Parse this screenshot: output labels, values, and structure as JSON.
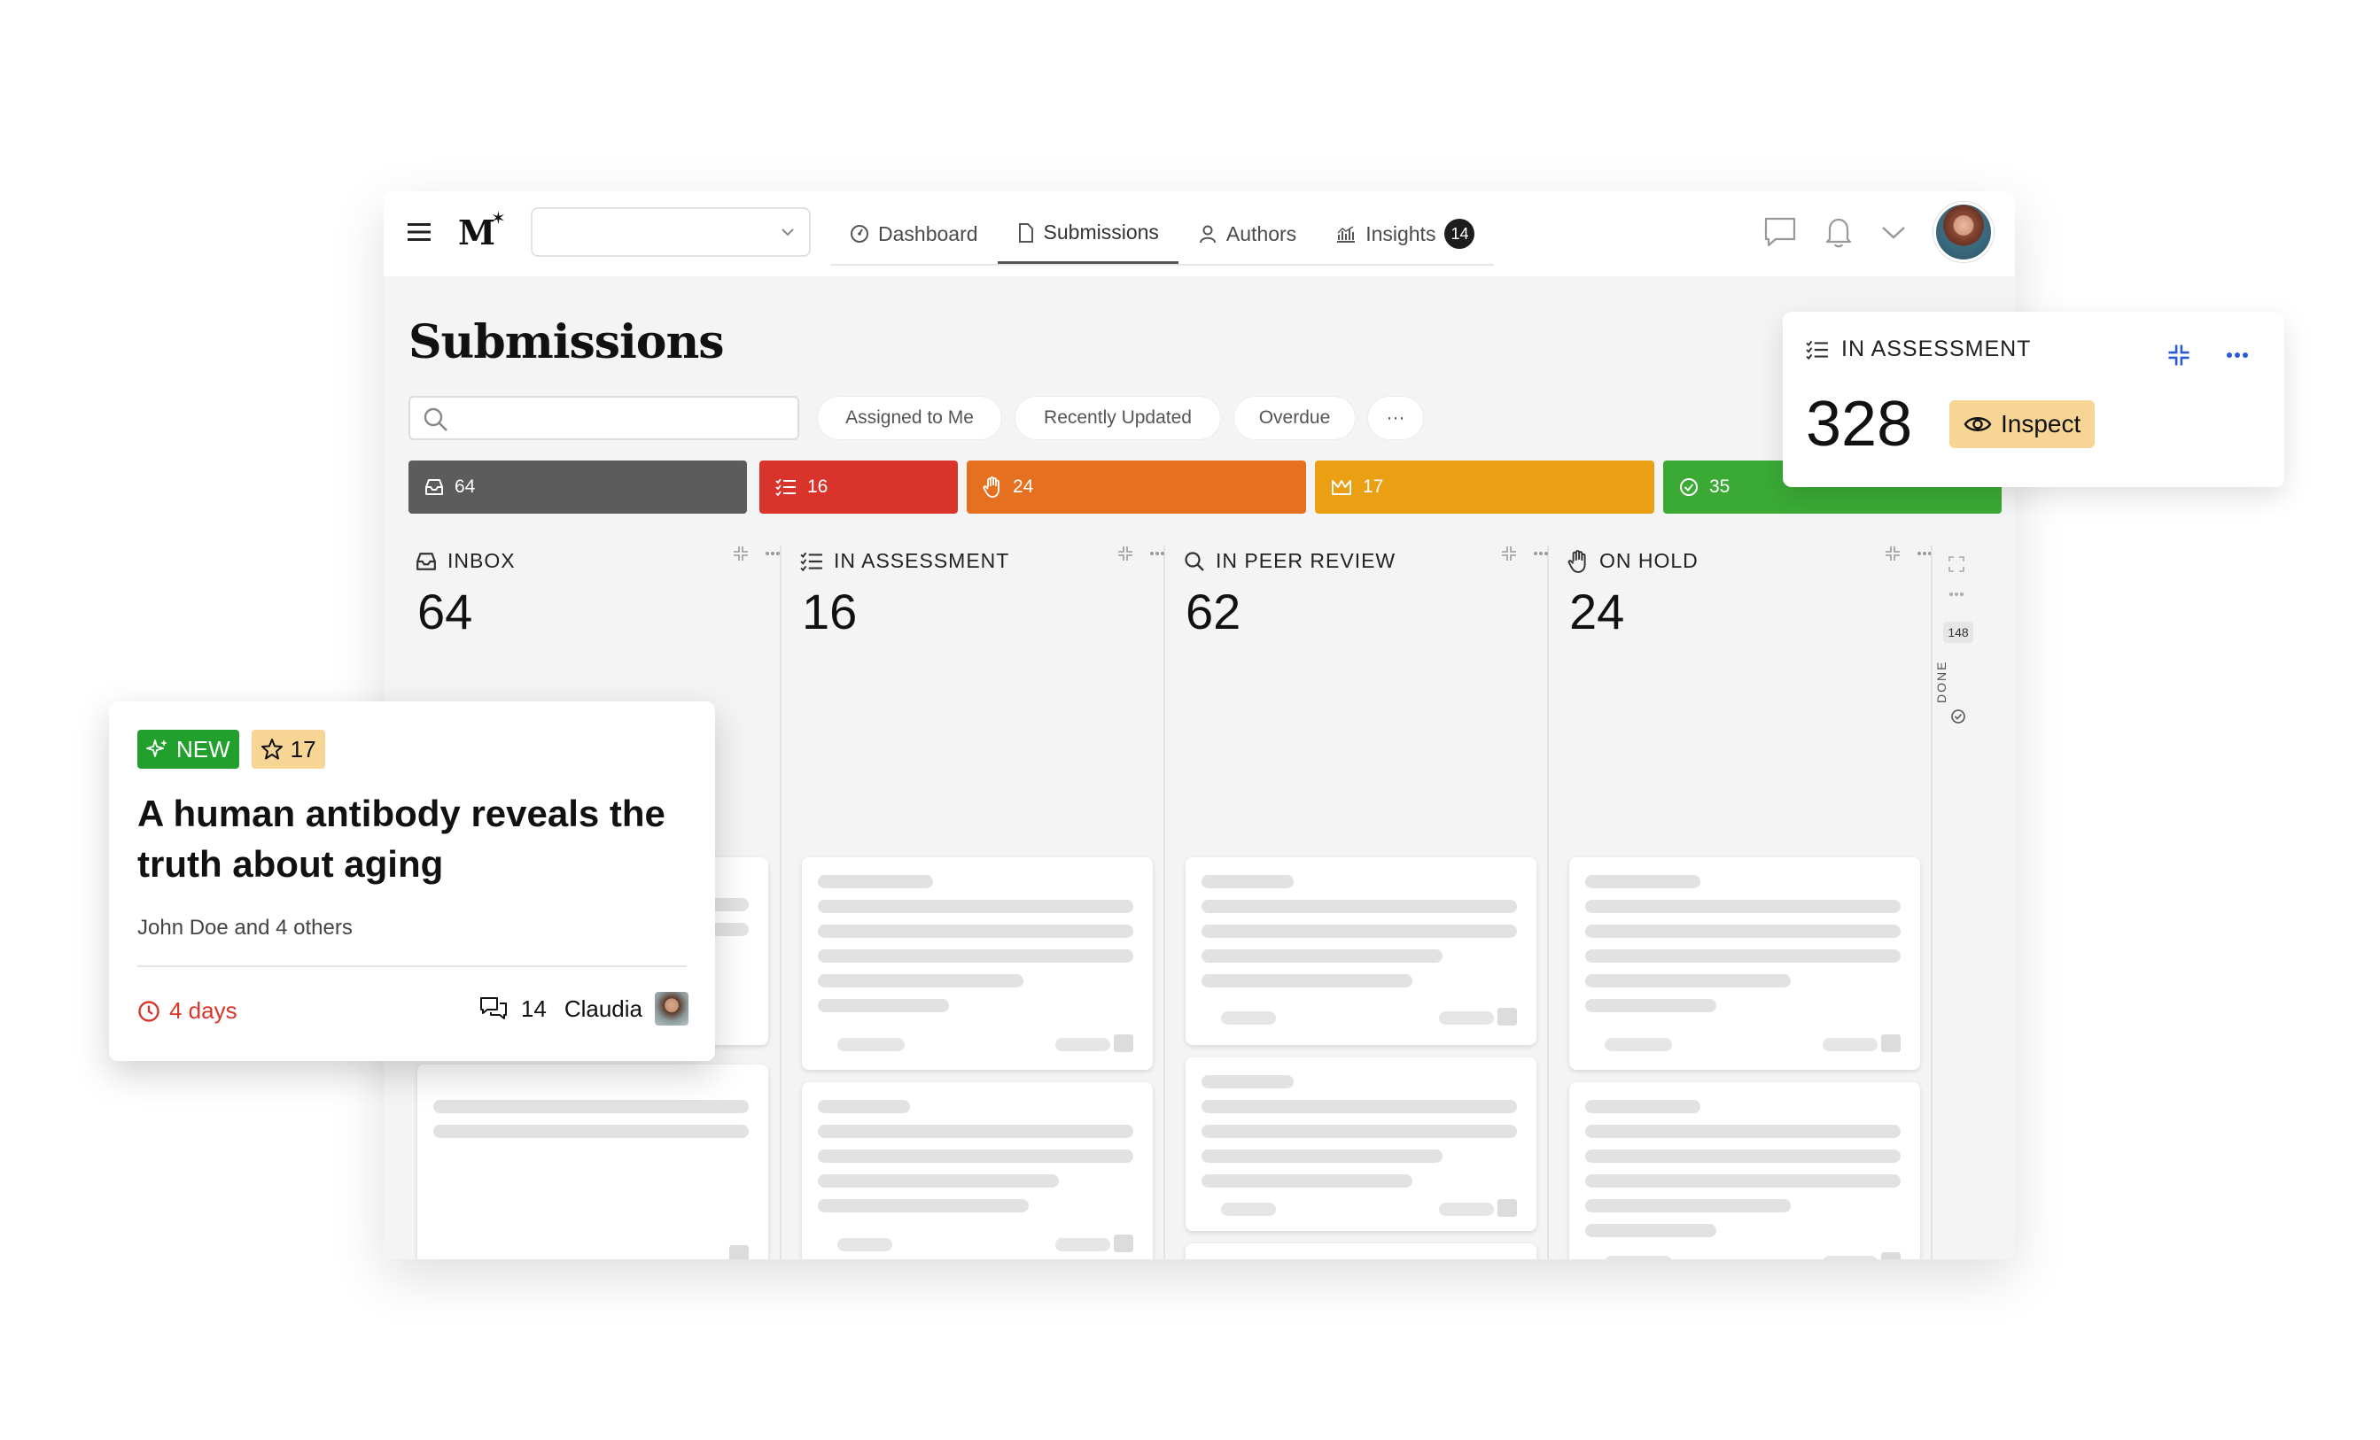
{
  "topbar": {
    "logo_text": "M",
    "logo_star": "✶",
    "site_select_value": "",
    "tabs": [
      {
        "label": "Dashboard",
        "icon": "dashboard-icon",
        "active": false
      },
      {
        "label": "Submissions",
        "icon": "document-icon",
        "active": true
      },
      {
        "label": "Authors",
        "icon": "person-icon",
        "active": false
      },
      {
        "label": "Insights",
        "icon": "chart-icon",
        "active": false,
        "badge": "14"
      }
    ]
  },
  "page": {
    "title": "Submissions",
    "search_placeholder": "",
    "filters": [
      "Assigned to Me",
      "Recently Updated",
      "Overdue",
      "···"
    ]
  },
  "status_bar": [
    {
      "label": "64",
      "icon": "inbox-icon",
      "color": "#5c5c5c"
    },
    {
      "label": "16",
      "icon": "checklist-icon",
      "color": "#d9342b"
    },
    {
      "label": "24",
      "icon": "hand-icon",
      "color": "#e57020"
    },
    {
      "label": "17",
      "icon": "crown-icon",
      "color": "#eba013"
    },
    {
      "label": "35",
      "icon": "check-circle-icon",
      "color": "#3aaa35"
    }
  ],
  "columns": [
    {
      "title": "INBOX",
      "icon": "inbox-icon",
      "count": "64"
    },
    {
      "title": "IN ASSESSMENT",
      "icon": "checklist-icon",
      "count": "16"
    },
    {
      "title": "IN PEER REVIEW",
      "icon": "search-icon",
      "count": "62"
    },
    {
      "title": "ON HOLD",
      "icon": "hand-icon",
      "count": "24"
    }
  ],
  "done_column": {
    "count": "148",
    "label": "DONE"
  },
  "assessment_panel": {
    "title": "IN ASSESSMENT",
    "count": "328",
    "inspect_label": "Inspect"
  },
  "article_card": {
    "badge_new": "NEW",
    "badge_star": "17",
    "title": "A human antibody reveals the truth about aging",
    "authors": "John Doe and 4 others",
    "due": "4 days",
    "comments": "14",
    "assignee": "Claudia"
  },
  "colors": {
    "new_badge": "#22a02d",
    "star_badge": "#f6d595",
    "overdue": "#d8352b",
    "accent_blue": "#2a5bd7"
  }
}
